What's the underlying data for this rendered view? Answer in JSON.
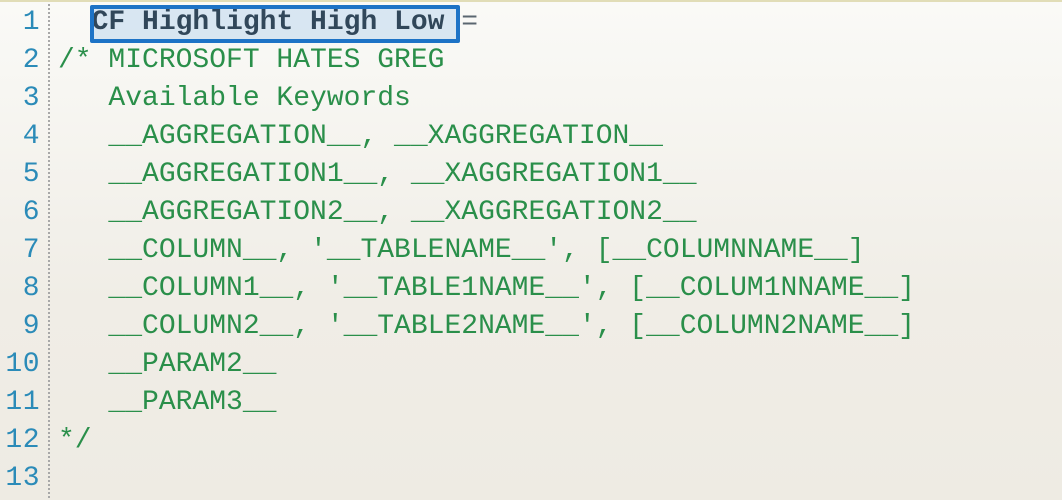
{
  "gutter": [
    "1",
    "2",
    "3",
    "4",
    "5",
    "6",
    "7",
    "8",
    "9",
    "10",
    "11",
    "12",
    "13"
  ],
  "code": {
    "l1_name": "CF Highlight High Low",
    "l1_eq": " =",
    "l2": "/* MICROSOFT HATES GREG",
    "l3": "   Available Keywords",
    "l4": "   __AGGREGATION__, __XAGGREGATION__",
    "l5": "   __AGGREGATION1__, __XAGGREGATION1__",
    "l6": "   __AGGREGATION2__, __XAGGREGATION2__",
    "l7": "   __COLUMN__, '__TABLENAME__', [__COLUMNNAME__]",
    "l8": "   __COLUMN1__, '__TABLE1NAME__', [__COLUM1NNAME__]",
    "l9": "   __COLUMN2__, '__TABLE2NAME__', [__COLUMN2NAME__]",
    "l10": "   __PARAM2__",
    "l11": "   __PARAM3__",
    "l12": "*/",
    "l13": ""
  },
  "selection": {
    "line": 1,
    "text": "CF Highlight High Low"
  }
}
